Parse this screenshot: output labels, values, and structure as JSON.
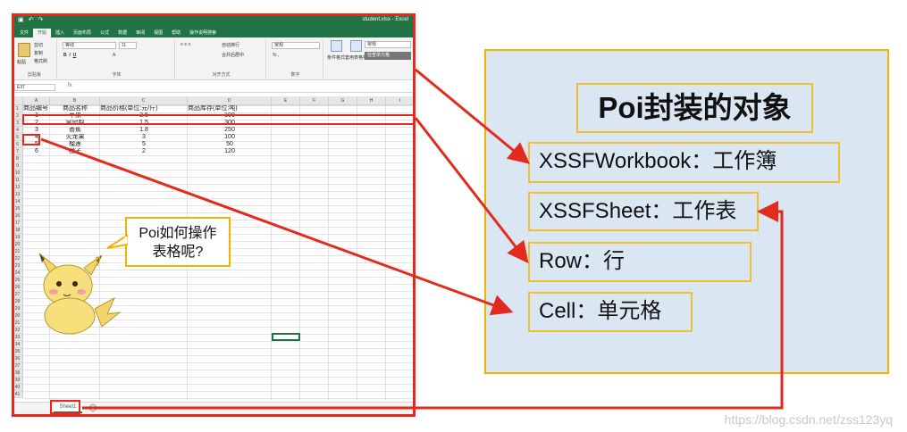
{
  "excel": {
    "quick_access": [
      "▣",
      "↶",
      "↷"
    ],
    "window_title": "student.xlsx - Excel",
    "tabs": [
      "文件",
      "开始",
      "插入",
      "页面布局",
      "公式",
      "数据",
      "审阅",
      "视图",
      "帮助",
      "操作说明搜索"
    ],
    "active_tab": "开始",
    "ribbon": {
      "paste": "粘贴",
      "cut": "剪切",
      "copy": "复制",
      "format_painter": "格式刷",
      "clipboard": "剪贴板",
      "font_name": "等线",
      "font_size": "11",
      "font_group": "字体",
      "wrap_text": "自动换行",
      "merge_center": "合并后居中",
      "alignment_group": "对齐方式",
      "number_format": "常规",
      "number_group": "数字",
      "conditional_format": "条件格式",
      "table_format": "套用表格格式",
      "style_normal": "常规",
      "style_bad": "检查单元格"
    },
    "name_box": "E37",
    "fx": "fx",
    "columns": [
      "A",
      "B",
      "C",
      "D",
      "E",
      "F",
      "G",
      "H",
      "I"
    ],
    "row_numbers": [
      "1",
      "2",
      "3",
      "4",
      "5",
      "6",
      "7",
      "8",
      "9",
      "10",
      "11",
      "12",
      "13",
      "14",
      "15",
      "16",
      "17",
      "18",
      "19",
      "20",
      "21",
      "22",
      "23",
      "24",
      "25",
      "26",
      "27",
      "28",
      "29",
      "30",
      "31",
      "32",
      "33",
      "34",
      "35",
      "36",
      "37",
      "38",
      "39",
      "40",
      "41"
    ],
    "header_row": [
      "商品编号",
      "商品名称",
      "商品价格(单位:元/斤)",
      "商品库存(单位:吨)"
    ],
    "rows": [
      [
        "1",
        "苹果",
        "2.5",
        "100"
      ],
      [
        "2",
        "皇冠梨",
        "1.5",
        "300"
      ],
      [
        "3",
        "香蕉",
        "1.8",
        "250"
      ],
      [
        "4",
        "火龙果",
        "3",
        "100"
      ],
      [
        "5",
        "榴莲",
        "5",
        "50"
      ],
      [
        "6",
        "橙子",
        "2",
        "120"
      ]
    ],
    "sheet_tab": "Sheet1",
    "add_sheet": "+"
  },
  "bubble": {
    "line1": "Poi如何操作",
    "line2": "表格呢?"
  },
  "panel": {
    "title": "Poi封装的对象",
    "items": [
      "XSSFWorkbook：工作簿",
      "XSSFSheet：工作表",
      "Row：行",
      "Cell：单元格"
    ]
  },
  "colors": {
    "excel_green": "#217346",
    "arrow_red": "#e22b1e",
    "box_border": "#f0c030",
    "panel_fill": "#dbe6f3"
  },
  "watermark": "https://blog.csdn.net/zss123yq"
}
